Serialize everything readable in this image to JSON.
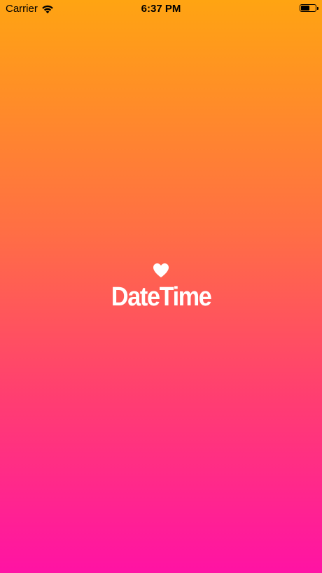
{
  "status_bar": {
    "carrier": "Carrier",
    "time": "6:37 PM",
    "battery_level": 0.6,
    "icons": [
      "wifi-icon",
      "battery-icon"
    ]
  },
  "splash": {
    "icon": "heart-icon",
    "app_name": "DateTime"
  },
  "colors": {
    "gradient_top": "#FFA412",
    "gradient_bottom": "#FF13A4",
    "logo": "#FFFFFF"
  }
}
